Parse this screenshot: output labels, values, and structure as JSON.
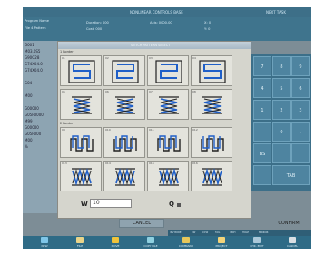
{
  "topbar": {
    "left_text": "",
    "center_text": "NONLINEAR CONTROLS BASE",
    "right_text": "NEXT TASK"
  },
  "info": {
    "line1": "Program Name",
    "line2": "File 4 Pattern",
    "speed_label": "Duration: 000",
    "coord_label": "Axis: 0000.00",
    "mode_label": "Cost: 000",
    "x_label": "X: 0",
    "y_label": "Y: 0"
  },
  "left_lines": [
    "G001",
    "M03.0S5",
    "G90G28",
    "G74X04.0",
    "G74X04.0",
    "",
    "G04",
    "",
    "M00",
    "",
    "G00000",
    "G05P0000",
    "M99",
    "G00000",
    "G05P000",
    "M00",
    "%"
  ],
  "numpad": {
    "keys": [
      "7",
      "8",
      "9",
      "4",
      "5",
      "6",
      "1",
      "2",
      "3",
      "-",
      "0",
      ".",
      "BS",
      "",
      "",
      "TAB",
      "",
      ""
    ]
  },
  "dialog": {
    "title": "STITCH PATTERN SELECT",
    "section1": "1 Border",
    "section2": "2 Border",
    "tiles_row1": [
      "01",
      "02",
      "03",
      "04"
    ],
    "tiles_row2": [
      "05",
      "06",
      "07",
      "08"
    ],
    "tiles_row3": [
      "09",
      "010",
      "011",
      "012"
    ],
    "tiles_row4": [
      "013",
      "014",
      "015",
      "016"
    ],
    "w_label": "W",
    "w_value": "10",
    "q_label": "Q"
  },
  "buttons": {
    "cancel": "CANCEL",
    "confirm": "CONFIRM"
  },
  "softkeys": [
    "INV BORE",
    "CW",
    "CCW",
    "TAIL",
    "INCH",
    "HOLE",
    "MIRROR"
  ],
  "toolbar": [
    {
      "label": "NEW",
      "icon": "monitor-icon"
    },
    {
      "label": "FILE",
      "icon": "folder-icon"
    },
    {
      "label": "MOVE",
      "icon": "move-icon"
    },
    {
      "label": "COPY FILE",
      "icon": "copy-icon"
    },
    {
      "label": "COMMAND",
      "icon": "command-icon"
    },
    {
      "label": "PROJECT",
      "icon": "project-icon"
    },
    {
      "label": "CHK. EDIT",
      "icon": "edit-icon"
    },
    {
      "label": "CANCEL",
      "icon": "cancel-icon"
    }
  ],
  "colors": {
    "accent": "#3d6f88",
    "dialog_bg": "#d5d5cd",
    "pattern_blue": "#1f5fc8",
    "pattern_black": "#222222"
  }
}
